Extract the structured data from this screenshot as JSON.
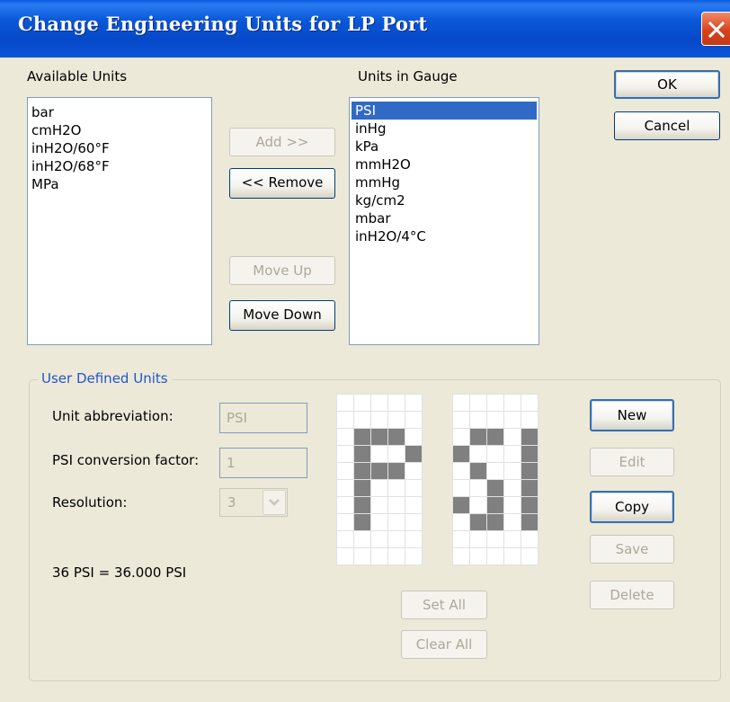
{
  "window": {
    "title": "Change Engineering Units for LP Port"
  },
  "available": {
    "label": "Available Units",
    "items": [
      "bar",
      "cmH2O",
      "inH2O/60°F",
      "inH2O/68°F",
      "MPa"
    ]
  },
  "gauge": {
    "label": "Units in Gauge",
    "items": [
      "PSI",
      "inHg",
      "kPa",
      "mmH2O",
      "mmHg",
      "kg/cm2",
      "mbar",
      "inH2O/4°C"
    ],
    "selected": "PSI"
  },
  "buttons": {
    "add": "Add >>",
    "remove": "<< Remove",
    "move_up": "Move Up",
    "move_down": "Move Down",
    "ok": "OK",
    "cancel": "Cancel",
    "new": "New",
    "edit": "Edit",
    "copy": "Copy",
    "save": "Save",
    "delete": "Delete",
    "set_all": "Set All",
    "clear_all": "Clear All"
  },
  "user_defined": {
    "group_title": "User Defined Units",
    "abbr_label": "Unit abbreviation:",
    "abbr_value": "PSI",
    "factor_label": "PSI conversion factor:",
    "factor_value": "1",
    "resolution_label": "Resolution:",
    "resolution_value": "3",
    "conversion_text": "36 PSI = 36.000 PSI"
  },
  "display_pattern": {
    "char1": [
      "00000",
      "00000",
      "01110",
      "01001",
      "01110",
      "01000",
      "01000",
      "01000",
      "00000",
      "00000"
    ],
    "char2": [
      "00000",
      "00000",
      "01101",
      "10001",
      "01001",
      "00101",
      "10101",
      "01101",
      "00000",
      "00000"
    ]
  }
}
